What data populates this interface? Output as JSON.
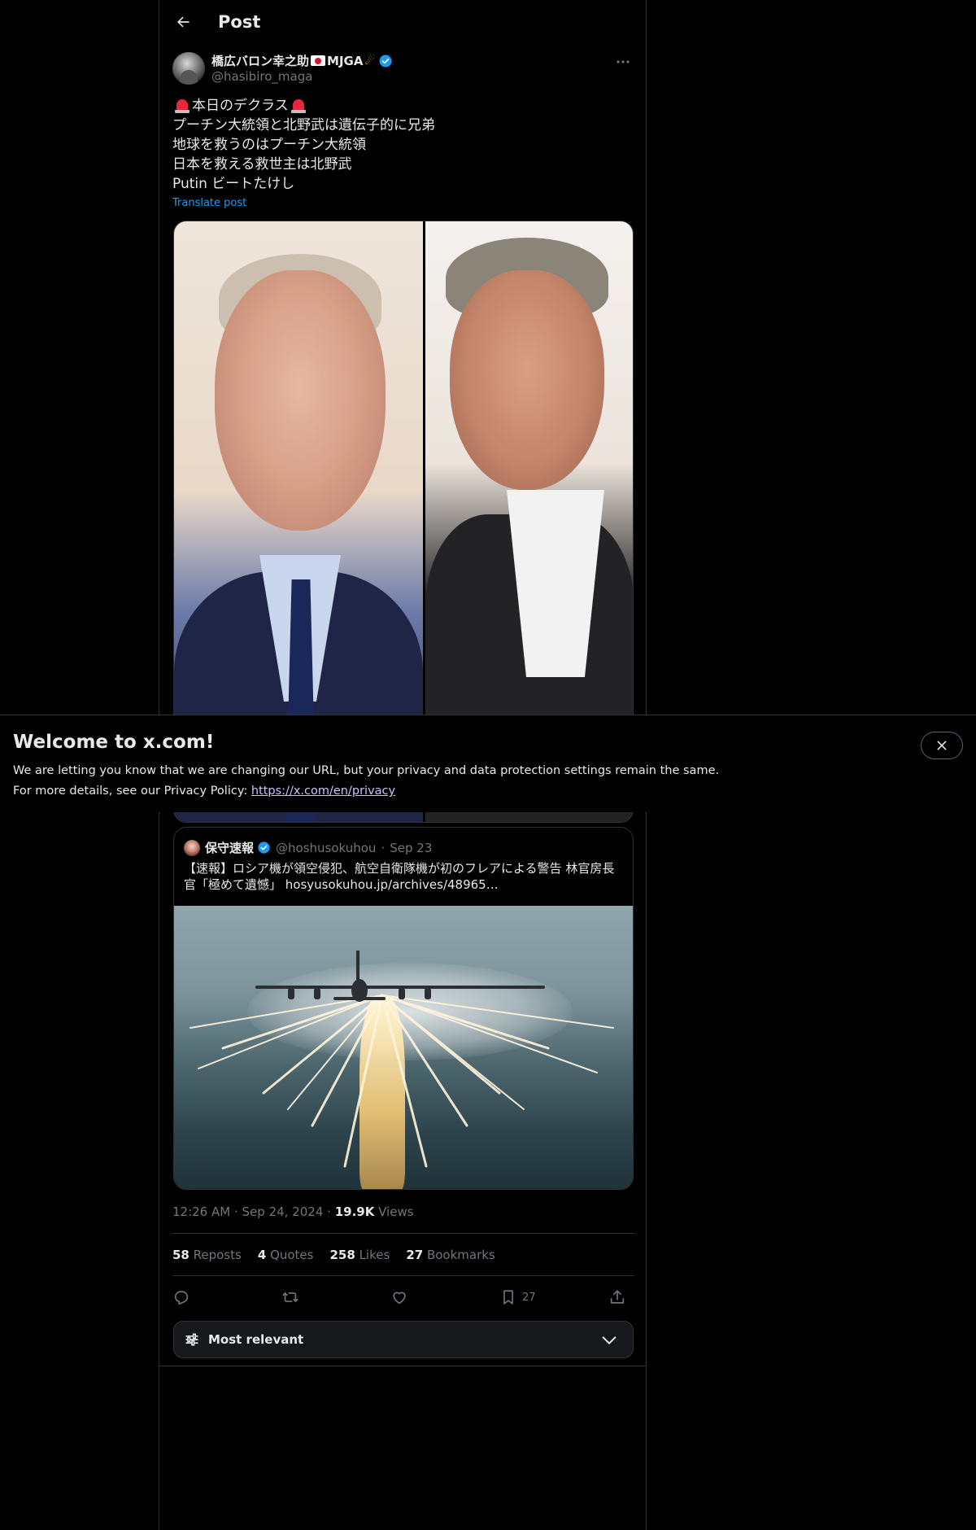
{
  "header": {
    "title": "Post"
  },
  "author": {
    "name_part1": "橋広バロン幸之助",
    "name_part2": "MJGA",
    "handle": "@hasibiro_maga"
  },
  "tweet": {
    "line1": "本日のデクラス",
    "line2": "プーチン大統領と北野武は遺伝子的に兄弟",
    "line3": "地球を救うのはプーチン大統領",
    "line4": "日本を救える救世主は北野武",
    "line5": "Putin ビートたけし",
    "translate_label": "Translate post"
  },
  "quote": {
    "name": "保守速報",
    "handle": "@hoshusokuhou",
    "date": "Sep 23",
    "text": "【速報】ロシア機が領空侵犯、航空自衛隊機が初のフレアによる警告 林官房長官「極めて遺憾」 hosyusokuhou.jp/archives/48965…"
  },
  "meta": {
    "time": "12:26 AM",
    "date": "Sep 24, 2024",
    "views_count": "19.9K",
    "views_label": "Views"
  },
  "stats": {
    "reposts_count": "58",
    "reposts_label": "Reposts",
    "quotes_count": "4",
    "quotes_label": "Quotes",
    "likes_count": "258",
    "likes_label": "Likes",
    "bookmarks_count": "27",
    "bookmarks_label": "Bookmarks"
  },
  "actions": {
    "bookmark_count": "27"
  },
  "sort": {
    "label": "Most relevant"
  },
  "banner": {
    "title": "Welcome to x.com!",
    "line1": "We are letting you know that we are changing our URL, but your privacy and data protection settings remain the same.",
    "line2": "For more details, see our Privacy Policy: ",
    "link": "https://x.com/en/privacy"
  },
  "colors": {
    "accent": "#1d9bf0",
    "background": "#000000",
    "border": "#2f3336",
    "muted": "#71767b"
  },
  "icons": [
    "back-arrow-icon",
    "verified-icon",
    "more-icon",
    "reply-icon",
    "repost-icon",
    "like-icon",
    "bookmark-icon",
    "share-icon",
    "sliders-icon",
    "chevron-down-icon",
    "close-icon"
  ]
}
